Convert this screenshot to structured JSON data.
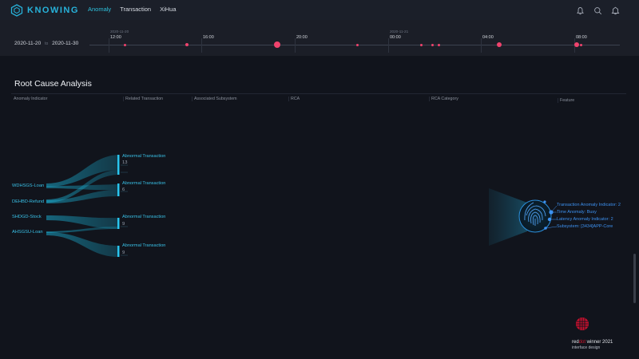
{
  "app": {
    "logo_text": "KNOWING",
    "nav": [
      {
        "label": "Anomaly",
        "active": true
      },
      {
        "label": "Transaction",
        "active": false
      },
      {
        "label": "XiHua",
        "active": false
      }
    ],
    "icons": [
      "bell-icon",
      "search-icon",
      "notification-icon"
    ]
  },
  "timeline": {
    "start_date": "2020-11-20",
    "separator": "to",
    "end_date": "2020-11-30",
    "date_markers": [
      "2020-11-20",
      "2020-11-21"
    ],
    "ticks": [
      "12:00",
      "16:00",
      "20:00",
      "00:00",
      "04:00",
      "08:00"
    ]
  },
  "rca": {
    "title": "Root Cause Analysis",
    "columns": [
      "Anomaly Indicator",
      "Related Transaction",
      "Associated Subsystem",
      "RCA",
      "RCA Category",
      "Feature"
    ],
    "indicators": [
      "WDHSGS-Loan",
      "DEHBD-Refund",
      "SHDGD-Stock",
      "AHSGSU-Loan"
    ],
    "transactions": [
      {
        "label": "Abnormal Transaction",
        "count": "13"
      },
      {
        "label": "Abnormal Transaction",
        "count": "6"
      },
      {
        "label": "Abnormal Transaction",
        "count": "9"
      },
      {
        "label": "Abnormal Transaction",
        "count": "9"
      }
    ],
    "features": [
      "Transaction Anomaly Indicator: 2",
      "Time Anomaly: Busy",
      "Latency Anomaly Indicator: 2",
      "Subsystem: [3434]APP-Core"
    ]
  },
  "award": {
    "line1_pre": "red",
    "line1_red": "dot",
    "line1_post": " winner 2021",
    "line2": "interface design"
  },
  "colors": {
    "accent": "#2ec0dc",
    "event": "#f0436d",
    "feature": "#3d91f0",
    "background": "#11141c"
  }
}
